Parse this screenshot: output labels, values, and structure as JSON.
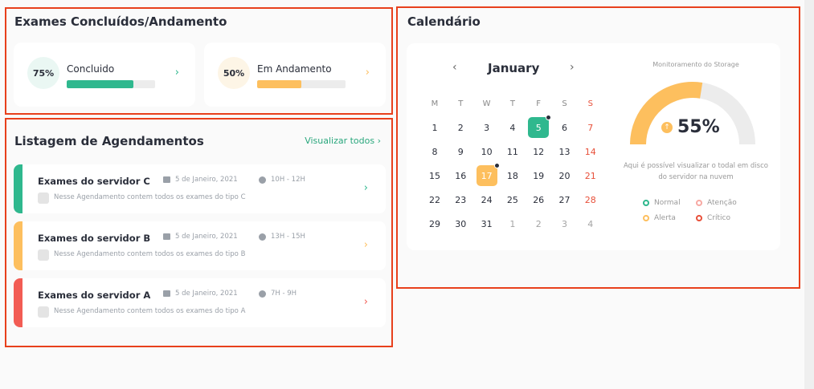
{
  "exames": {
    "title": "Exames Concluídos/Andamento",
    "cards": [
      {
        "percent_label": "75%",
        "label": "Concluido",
        "progress": 0.75,
        "color": "#2fb88e",
        "bg": "#eaf7f3",
        "chevron": "›"
      },
      {
        "percent_label": "50%",
        "label": "Em Andamento",
        "progress": 0.5,
        "color": "#fdbf5e",
        "bg": "#fdf5e6",
        "chevron": "›"
      }
    ]
  },
  "listagem": {
    "title": "Listagem de Agendamentos",
    "view_all": "Visualizar todos ›",
    "items": [
      {
        "title": "Exames do servidor C",
        "date": "5 de Janeiro, 2021",
        "time": "10H - 12H",
        "desc": "Nesse Agendamento contem todos os exames do tipo C",
        "color": "#2fb88e",
        "chevron": "›"
      },
      {
        "title": "Exames do servidor B",
        "date": "5 de Janeiro, 2021",
        "time": "13H - 15H",
        "desc": "Nesse Agendamento contem todos os exames do tipo B",
        "color": "#fdbf5e",
        "chevron": "›"
      },
      {
        "title": "Exames do servidor A",
        "date": "5 de Janeiro, 2021",
        "time": "7H - 9H",
        "desc": "Nesse Agendamento contem todos os exames do tipo A",
        "color": "#f25c54",
        "chevron": "›"
      }
    ]
  },
  "calendario": {
    "title": "Calendário",
    "month": "January",
    "prev": "‹",
    "next": "›",
    "weekdays": [
      "M",
      "T",
      "W",
      "T",
      "F",
      "S",
      "S"
    ],
    "weeks": [
      [
        "1",
        "2",
        "3",
        "4",
        "5",
        "6",
        "7"
      ],
      [
        "8",
        "9",
        "10",
        "11",
        "12",
        "13",
        "14"
      ],
      [
        "15",
        "16",
        "17",
        "18",
        "19",
        "20",
        "21"
      ],
      [
        "22",
        "23",
        "24",
        "25",
        "26",
        "27",
        "28"
      ],
      [
        "29",
        "30",
        "31",
        "1",
        "2",
        "3",
        "4"
      ]
    ],
    "highlight_green": "5",
    "highlight_orange": "17"
  },
  "storage": {
    "title": "Monitoramento do Storage",
    "value": "55%",
    "fraction": 0.55,
    "arrow": "↑",
    "desc": "Aqui é possível visualizar o todal em disco do servidor na nuvem",
    "legend": [
      {
        "label": "Normal",
        "color": "#2fb88e"
      },
      {
        "label": "Atenção",
        "color": "#f7a9a3"
      },
      {
        "label": "Alerta",
        "color": "#fdbf5e"
      },
      {
        "label": "Crítico",
        "color": "#e8503a"
      }
    ]
  }
}
